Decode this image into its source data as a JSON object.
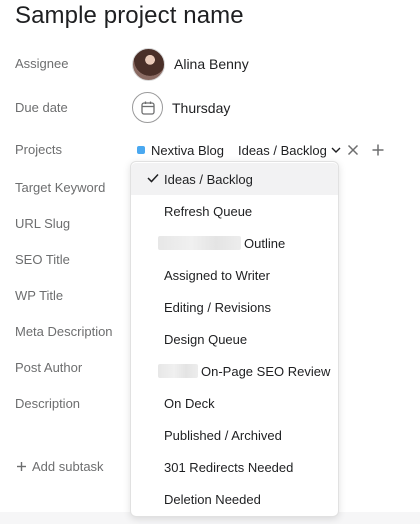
{
  "task": {
    "title": "Sample project name"
  },
  "fields": {
    "assignee": {
      "label": "Assignee",
      "name": "Alina Benny"
    },
    "due_date": {
      "label": "Due date",
      "value": "Thursday"
    },
    "projects": {
      "label": "Projects",
      "project_name": "Nextiva Blog",
      "project_color": "#4aa8f0",
      "section": "Ideas / Backlog"
    },
    "target_keyword": {
      "label": "Target Keyword"
    },
    "url_slug": {
      "label": "URL Slug"
    },
    "seo_title": {
      "label": "SEO Title"
    },
    "wp_title": {
      "label": "WP Title"
    },
    "meta_description": {
      "label": "Meta Description"
    },
    "post_author": {
      "label": "Post Author"
    },
    "description": {
      "label": "Description"
    }
  },
  "section_dropdown": {
    "selected_index": 0,
    "options": [
      {
        "label": "Ideas / Backlog"
      },
      {
        "label": "Refresh Queue"
      },
      {
        "label": "Outline",
        "redacted_prefix": true
      },
      {
        "label": "Assigned to Writer"
      },
      {
        "label": "Editing / Revisions"
      },
      {
        "label": "Design Queue"
      },
      {
        "label": "On-Page SEO Review",
        "redacted_prefix": true
      },
      {
        "label": "On Deck"
      },
      {
        "label": "Published / Archived"
      },
      {
        "label": "301 Redirects Needed"
      },
      {
        "label": "Deletion Needed"
      }
    ]
  },
  "subtasks": {
    "add_label": "Add subtask"
  },
  "icons": {
    "calendar": "calendar-icon",
    "close": "close-icon",
    "plus": "plus-icon",
    "chevron": "chevron-down-icon",
    "check": "check-icon"
  }
}
